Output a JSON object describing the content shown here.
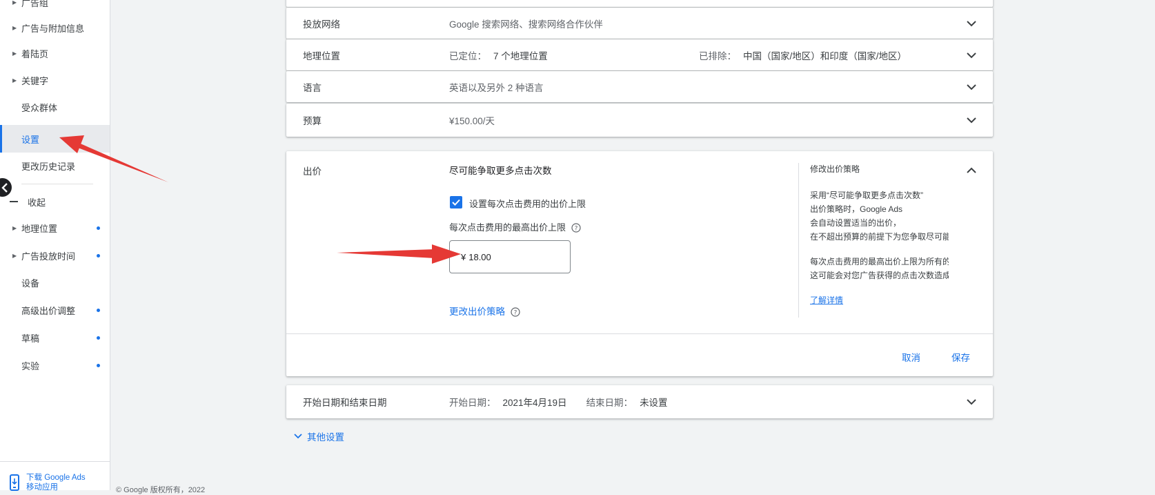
{
  "sidebar": {
    "items": [
      {
        "label": "广告组",
        "caret": true,
        "dot": false
      },
      {
        "label": "广告与附加信息",
        "caret": true,
        "dot": false
      },
      {
        "label": "着陆页",
        "caret": true,
        "dot": false
      },
      {
        "label": "关键字",
        "caret": true,
        "dot": false
      },
      {
        "label": "受众群体",
        "caret": false,
        "dot": false
      },
      {
        "label": "设置",
        "caret": false,
        "dot": false,
        "active": true
      },
      {
        "label": "更改历史记录",
        "caret": false,
        "dot": false
      }
    ],
    "collapse_label": "收起",
    "more_items": [
      {
        "label": "地理位置",
        "caret": true,
        "dot": true
      },
      {
        "label": "广告投放时间",
        "caret": true,
        "dot": true
      },
      {
        "label": "设备",
        "caret": false,
        "dot": false
      },
      {
        "label": "高级出价调整",
        "caret": false,
        "dot": true
      },
      {
        "label": "草稿",
        "caret": false,
        "dot": true
      },
      {
        "label": "实验",
        "caret": false,
        "dot": true
      }
    ],
    "download_line1": "下载 Google Ads",
    "download_line2": "移动应用"
  },
  "footer": {
    "copyright": "© Google 版权所有，2022"
  },
  "settings": {
    "network": {
      "title": "投放网络",
      "summary": "Google 搜索网络、搜索网络合作伙伴"
    },
    "locations": {
      "title": "地理位置",
      "targeted_label": "已定位：",
      "targeted_value": "7 个地理位置",
      "excluded_label": "已排除：",
      "excluded_value": "中国（国家/地区）和印度（国家/地区）"
    },
    "language": {
      "title": "语言",
      "summary": "英语以及另外 2 种语言"
    },
    "budget": {
      "title": "预算",
      "summary": "¥150.00/天"
    },
    "bidding": {
      "title": "出价",
      "strategy": "尽可能争取更多点击次数",
      "checkbox_label": "设置每次点击费用的出价上限",
      "checkbox_checked": true,
      "max_cpc_label": "每次点击费用的最高出价上限",
      "currency": "¥",
      "max_cpc_value": "18.00",
      "change_strategy": "更改出价策略",
      "info_title": "修改出价策略",
      "info_p1_lines": [
        "采用“尽可能争取更多点击次数”",
        "出价策略时，Google Ads",
        "会自动设置适当的出价，",
        "在不超出预算的前提下为您争取尽可能"
      ],
      "info_p2_lines": [
        "每次点击费用的最高出价上限为所有的",
        "这可能会对您广告获得的点击次数造成"
      ],
      "learn_more": "了解详情",
      "cancel": "取消",
      "save": "保存"
    },
    "dates": {
      "title": "开始日期和结束日期",
      "start_label": "开始日期：",
      "start_value": "2021年4月19日",
      "end_label": "结束日期：",
      "end_value": "未设置"
    },
    "other_settings": "其他设置"
  },
  "colors": {
    "accent": "#1a73e8",
    "annotation_arrow": "#e53935",
    "background": "#f1f3f4"
  }
}
